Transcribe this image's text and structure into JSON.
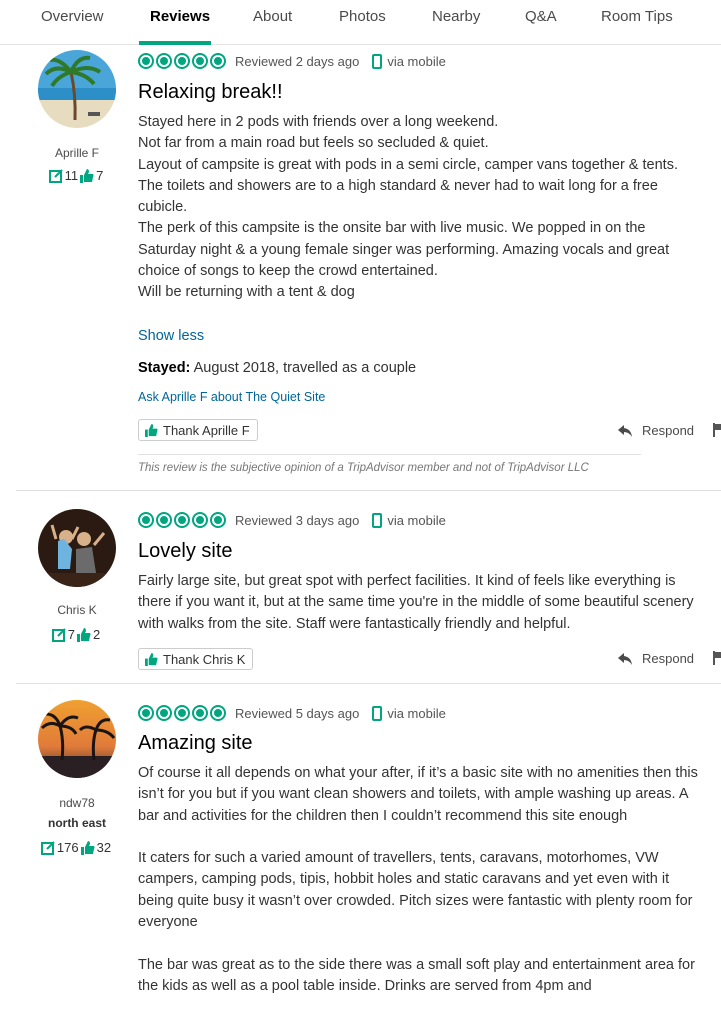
{
  "tabs": [
    {
      "label": "Overview",
      "active": false
    },
    {
      "label": "Reviews",
      "active": true
    },
    {
      "label": "About",
      "active": false
    },
    {
      "label": "Photos",
      "active": false
    },
    {
      "label": "Nearby",
      "active": false
    },
    {
      "label": "Q&A",
      "active": false
    },
    {
      "label": "Room Tips",
      "active": false
    }
  ],
  "colors": {
    "accent": "#00a680",
    "link": "#006699"
  },
  "reviews": [
    {
      "user": {
        "name": "Aprille F",
        "location": "",
        "contributions": "11",
        "helpful_votes": "7",
        "avatar_icon": "palm-beach-avatar"
      },
      "rating_bubbles": 5,
      "reviewed": "Reviewed 2 days ago",
      "via": "via mobile",
      "title": "Relaxing break!!",
      "body": [
        "Stayed here in 2 pods with friends over a long weekend.",
        "Not far from a main road but feels so secluded & quiet.",
        "Layout of campsite is great with pods in a semi circle, camper vans together & tents.",
        "The toilets and showers are to a high standard & never had to wait long for a free cubicle.",
        "The perk of this campsite is the onsite bar with live music. We popped in on the Saturday night & a young female singer was performing. Amazing vocals and great choice of songs to keep the crowd entertained.",
        "Will be returning with a tent & dog"
      ],
      "show_less": "Show less",
      "stayed_label": "Stayed:",
      "stayed_value": " August 2018, travelled as a couple",
      "ask": "Ask Aprille F about The Quiet Site",
      "thank": "Thank Aprille F",
      "respond": "Respond",
      "disclaimer": "This review is the subjective opinion of a TripAdvisor member and not of TripAdvisor LLC"
    },
    {
      "user": {
        "name": "Chris K",
        "location": "",
        "contributions": "7",
        "helpful_votes": "2",
        "avatar_icon": "people-photo-avatar"
      },
      "rating_bubbles": 5,
      "reviewed": "Reviewed 3 days ago",
      "via": "via mobile",
      "title": "Lovely site",
      "body": [
        "Fairly large site, but great spot with perfect facilities. It kind of feels like everything is there if you want it, but at the same time you're in the middle of some beautiful scenery with walks from the site. Staff were fantastically friendly and helpful."
      ],
      "thank": "Thank Chris K",
      "respond": "Respond"
    },
    {
      "user": {
        "name": "ndw78",
        "location": "north east",
        "contributions": "176",
        "helpful_votes": "32",
        "avatar_icon": "sunset-palms-avatar"
      },
      "rating_bubbles": 5,
      "reviewed": "Reviewed 5 days ago",
      "via": "via mobile",
      "title": "Amazing site",
      "body": [
        "Of course it all depends on what your after, if it’s a basic site with no amenities then this isn’t for you but if you want clean showers and toilets, with ample washing up areas. A bar and activities for the children then I couldn’t recommend this site enough",
        "It caters for such a varied amount of travellers, tents, caravans, motorhomes, VW campers, camping pods, tipis, hobbit holes and static caravans and yet even with it being quite busy it wasn’t over crowded. Pitch sizes were fantastic with plenty room for everyone",
        "The bar was great as to the side there was a small soft play and entertainment area for the kids as well as a pool table inside. Drinks are served from 4pm and"
      ]
    }
  ]
}
